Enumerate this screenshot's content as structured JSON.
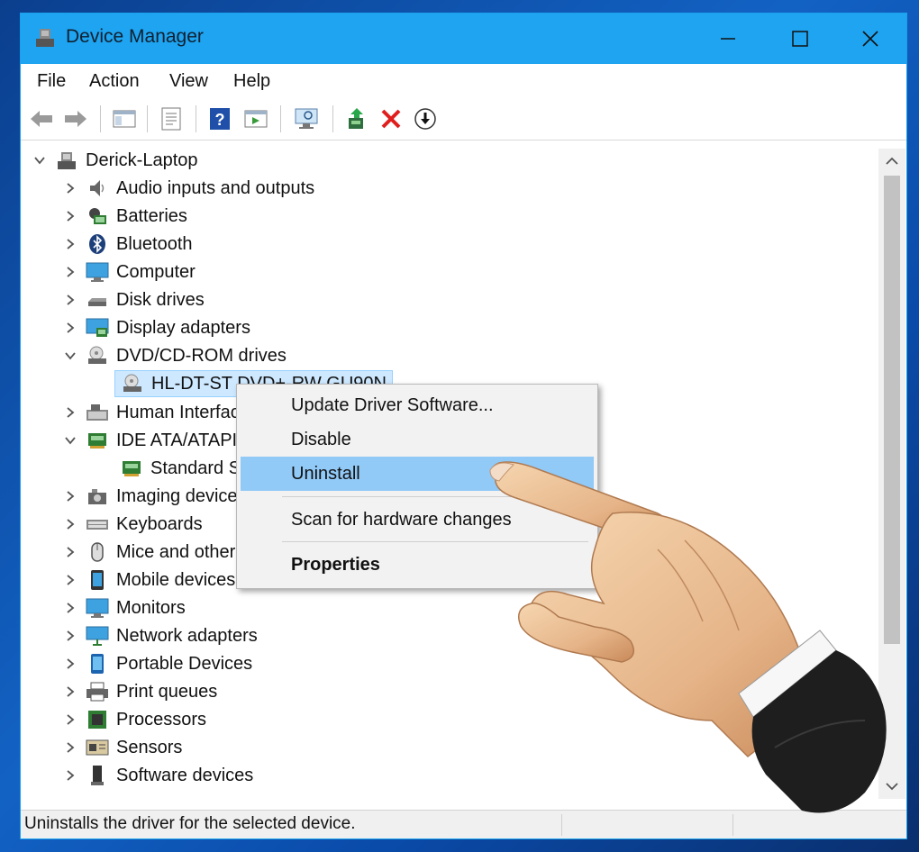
{
  "window": {
    "title": "Device Manager"
  },
  "menubar": {
    "items": [
      "File",
      "Action",
      "View",
      "Help"
    ]
  },
  "toolbar": {
    "icons": [
      "back-icon",
      "forward-icon",
      "show-hide-tree-icon",
      "properties-icon",
      "help-icon",
      "run-icon",
      "scan-hardware-icon",
      "update-driver-icon",
      "uninstall-icon",
      "disable-icon"
    ]
  },
  "tree": {
    "root": "Derick-Laptop",
    "items": [
      {
        "label": "Audio inputs and outputs",
        "expanded": false
      },
      {
        "label": "Batteries",
        "expanded": false
      },
      {
        "label": "Bluetooth",
        "expanded": false
      },
      {
        "label": "Computer",
        "expanded": false
      },
      {
        "label": "Disk drives",
        "expanded": false
      },
      {
        "label": "Display adapters",
        "expanded": false
      },
      {
        "label": "DVD/CD-ROM drives",
        "expanded": true
      },
      {
        "label": "HL-DT-ST DVD+-RW GU90N",
        "child": true,
        "selected": true
      },
      {
        "label": "Human Interface Devices",
        "expanded": false
      },
      {
        "label": "IDE ATA/ATAPI controllers",
        "expanded": true
      },
      {
        "label": "Standard SATA AHCI Controller",
        "child": true
      },
      {
        "label": "Imaging devices",
        "expanded": false
      },
      {
        "label": "Keyboards",
        "expanded": false
      },
      {
        "label": "Mice and other pointing devices",
        "expanded": false
      },
      {
        "label": "Mobile devices",
        "expanded": false
      },
      {
        "label": "Monitors",
        "expanded": false
      },
      {
        "label": "Network adapters",
        "expanded": false
      },
      {
        "label": "Portable Devices",
        "expanded": false
      },
      {
        "label": "Print queues",
        "expanded": false
      },
      {
        "label": "Processors",
        "expanded": false
      },
      {
        "label": "Sensors",
        "expanded": false
      },
      {
        "label": "Software devices",
        "expanded": false
      }
    ]
  },
  "context_menu": {
    "items": [
      "Update Driver Software...",
      "Disable",
      "Uninstall",
      "Scan for hardware changes",
      "Properties"
    ],
    "highlighted": "Uninstall"
  },
  "status": {
    "text": "Uninstalls the driver for the selected device."
  },
  "colors": {
    "titlebar": "#1ea4f0",
    "highlight": "#91c9f7",
    "selection": "#cde8ff"
  }
}
